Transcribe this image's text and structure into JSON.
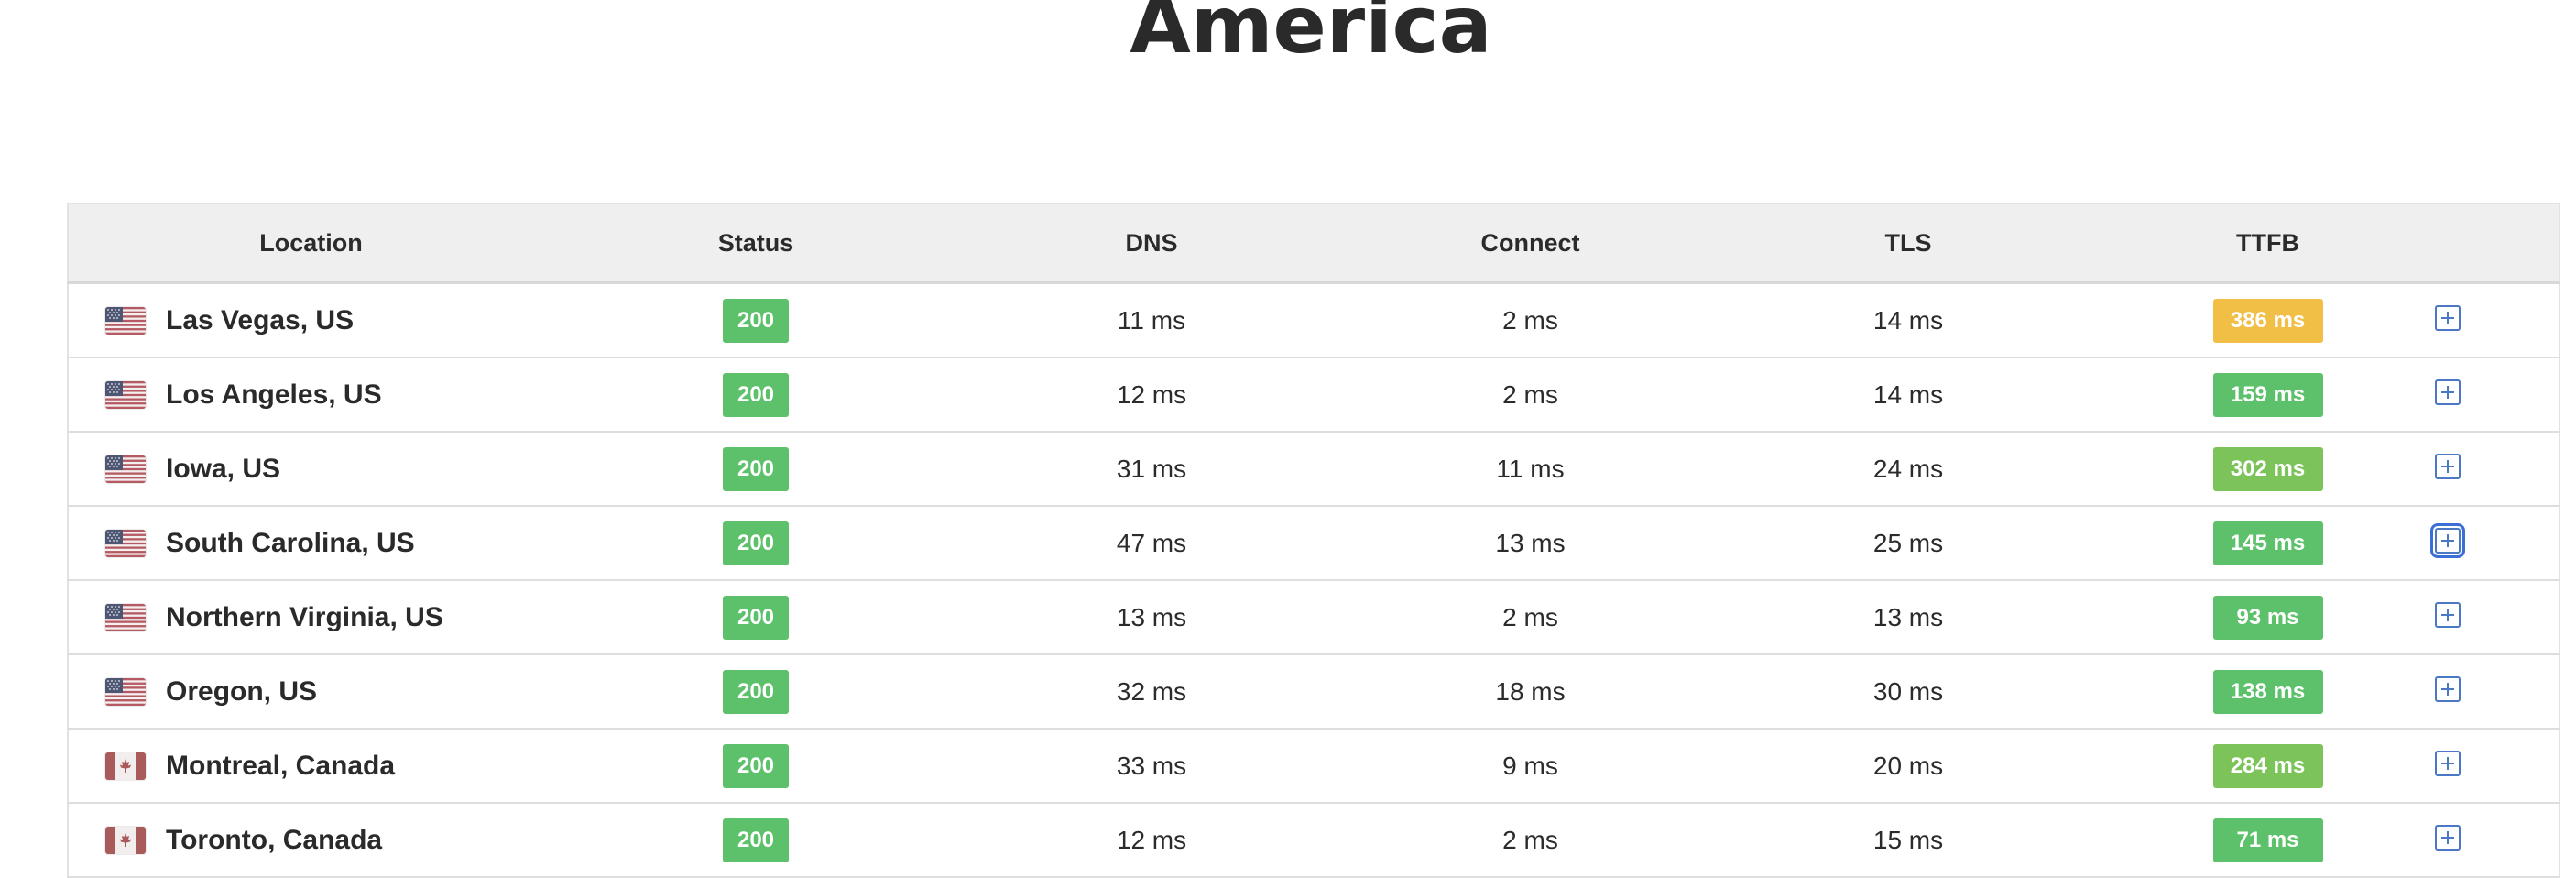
{
  "page": {
    "title": "America"
  },
  "table": {
    "headers": {
      "location": "Location",
      "status": "Status",
      "dns": "DNS",
      "connect": "Connect",
      "tls": "TLS",
      "ttfb": "TTFB"
    },
    "rows": [
      {
        "flag": "us-flag-icon",
        "location": "Las Vegas, US",
        "status": "200",
        "dns": "11 ms",
        "connect": "2 ms",
        "tls": "14 ms",
        "ttfb": "386 ms",
        "ttfb_color": "#f2bf46"
      },
      {
        "flag": "us-flag-icon",
        "location": "Los Angeles, US",
        "status": "200",
        "dns": "12 ms",
        "connect": "2 ms",
        "tls": "14 ms",
        "ttfb": "159 ms",
        "ttfb_color": "#5cc16a"
      },
      {
        "flag": "us-flag-icon",
        "location": "Iowa, US",
        "status": "200",
        "dns": "31 ms",
        "connect": "11 ms",
        "tls": "24 ms",
        "ttfb": "302 ms",
        "ttfb_color": "#7cc45a"
      },
      {
        "flag": "us-flag-icon",
        "location": "South Carolina, US",
        "status": "200",
        "dns": "47 ms",
        "connect": "13 ms",
        "tls": "25 ms",
        "ttfb": "145 ms",
        "ttfb_color": "#5cc16a"
      },
      {
        "flag": "us-flag-icon",
        "location": "Northern Virginia, US",
        "status": "200",
        "dns": "13 ms",
        "connect": "2 ms",
        "tls": "13 ms",
        "ttfb": "93 ms",
        "ttfb_color": "#5cc16a"
      },
      {
        "flag": "us-flag-icon",
        "location": "Oregon, US",
        "status": "200",
        "dns": "32 ms",
        "connect": "18 ms",
        "tls": "30 ms",
        "ttfb": "138 ms",
        "ttfb_color": "#5cc16a"
      },
      {
        "flag": "ca-flag-icon",
        "location": "Montreal, Canada",
        "status": "200",
        "dns": "33 ms",
        "connect": "9 ms",
        "tls": "20 ms",
        "ttfb": "284 ms",
        "ttfb_color": "#7cc45a"
      },
      {
        "flag": "ca-flag-icon",
        "location": "Toronto, Canada",
        "status": "200",
        "dns": "12 ms",
        "connect": "2 ms",
        "tls": "15 ms",
        "ttfb": "71 ms",
        "ttfb_color": "#5cc16a"
      }
    ]
  },
  "colors": {
    "status_ok": "#5cc16a",
    "expand_icon": "#4a78c5",
    "header_bg": "#efefef"
  }
}
